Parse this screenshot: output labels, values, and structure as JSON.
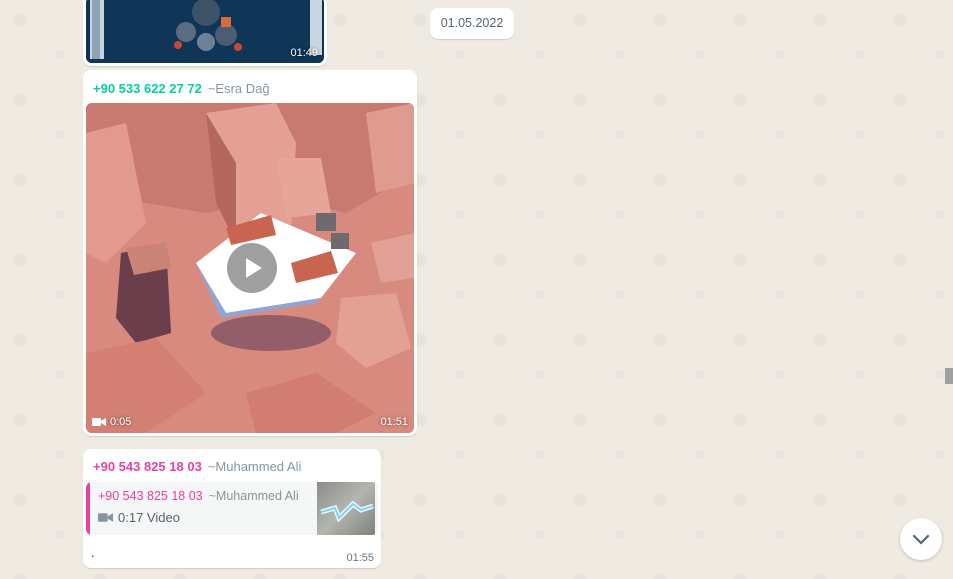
{
  "date_divider": "01.05.2022",
  "messages": [
    {
      "type": "video",
      "time": "01:49"
    },
    {
      "type": "video",
      "sender_phone": "+90 533 622 27 72",
      "sender_name": "~Esra Dağ",
      "duration": "0:05",
      "time": "01:51"
    },
    {
      "type": "reply",
      "sender_phone": "+90 543 825 18 03",
      "sender_name": "~Muhammed Ali",
      "quoted": {
        "sender_phone": "+90 543 825 18 03",
        "sender_name": "~Muhammed Ali",
        "text": "0:17 Video"
      },
      "text": ".",
      "time": "01:55"
    }
  ],
  "colors": {
    "sender1": "#06cf9c",
    "sender2": "#e542a3",
    "chat_bg": "#efeae2"
  },
  "icons": [
    "video-camera-icon",
    "play-icon",
    "chevron-down-icon"
  ]
}
